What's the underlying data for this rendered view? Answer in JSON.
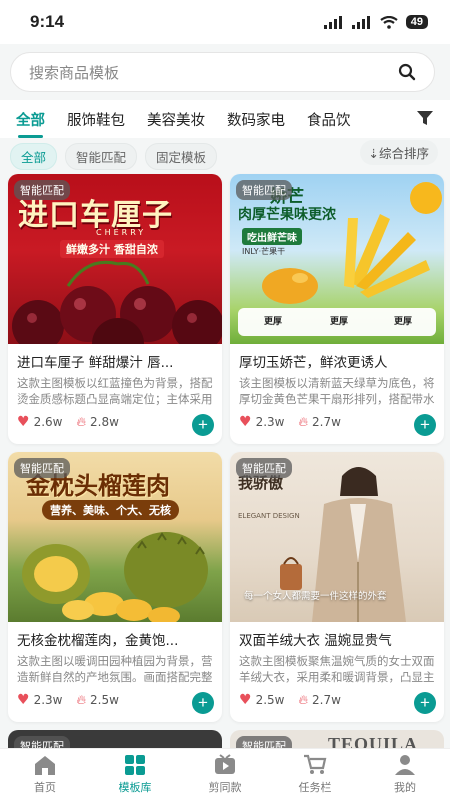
{
  "status": {
    "time": "9:14",
    "battery": "49"
  },
  "search": {
    "placeholder": "搜索商品模板"
  },
  "categories": [
    "全部",
    "服饰鞋包",
    "美容美妆",
    "数码家电",
    "食品饮"
  ],
  "chips": [
    "全部",
    "智能匹配",
    "固定模板"
  ],
  "sort_label": "综合排序",
  "cards": [
    {
      "badge": "智能匹配",
      "title": "进口车厘子 鲜甜爆汁 唇...",
      "desc": "这款主图模板以红蓝撞色为背景，搭配烫金质感标题凸显高端定位；主体采用带水珠的饱满...",
      "likes": "2.6w",
      "hot": "2.8w",
      "overlay": {
        "title": "进口车厘子",
        "sub": "CHERRY",
        "tag": "鲜嫩多汁 香甜自浓"
      }
    },
    {
      "badge": "智能匹配",
      "title": "厚切玉娇芒，鲜浓更诱人",
      "desc": "该主图模板以清新蓝天绿草为底色，将厚切金黄色芒果干扇形排列，搭配带水珠的鲜芒果与爆...",
      "likes": "2.3w",
      "hot": "2.7w",
      "overlay": {
        "title": "娇芒",
        "line2": "肉厚芒果味更浓",
        "tag": "吃出鲜芒味",
        "brand": "INLY·芒果干",
        "f1": "更厚",
        "f2": "更厚",
        "f3": "更厚"
      }
    },
    {
      "badge": "智能匹配",
      "title": "无核金枕榴莲肉，金黄饱...",
      "desc": "这款主图以暖调田园种植园为背景，营造新鲜自然的产地氛围。画面搭配完整带壳榴莲、剥开的...",
      "likes": "2.3w",
      "hot": "2.5w",
      "overlay": {
        "title": "金枕头榴莲肉",
        "tag": "营养、美味、个大、无核"
      }
    },
    {
      "badge": "智能匹配",
      "title": "双面羊绒大衣 温婉显贵气",
      "desc": "这款主图模板聚焦温婉气质的女士双面羊绒大衣，采用柔和暖调背景，凸显主大衣浅卡其色的雅...",
      "likes": "2.5w",
      "hot": "2.7w",
      "overlay": {
        "title": "我骄傲",
        "sub": "ELEGANT DESIGN",
        "quote": "每一个女人都需要一件这样的外套"
      }
    }
  ],
  "peek_cards": [
    {
      "badge": "智能匹配",
      "text": ""
    },
    {
      "badge": "智能匹配",
      "text": "TEQUILA"
    }
  ],
  "nav": [
    {
      "label": "首页",
      "icon": "home-icon"
    },
    {
      "label": "模板库",
      "icon": "template-icon"
    },
    {
      "label": "剪同款",
      "icon": "video-icon"
    },
    {
      "label": "任务栏",
      "icon": "cart-icon"
    },
    {
      "label": "我的",
      "icon": "user-icon"
    }
  ],
  "colors": {
    "accent": "#0a9b93",
    "like": "#e8505b",
    "hot": "#e8505b"
  }
}
